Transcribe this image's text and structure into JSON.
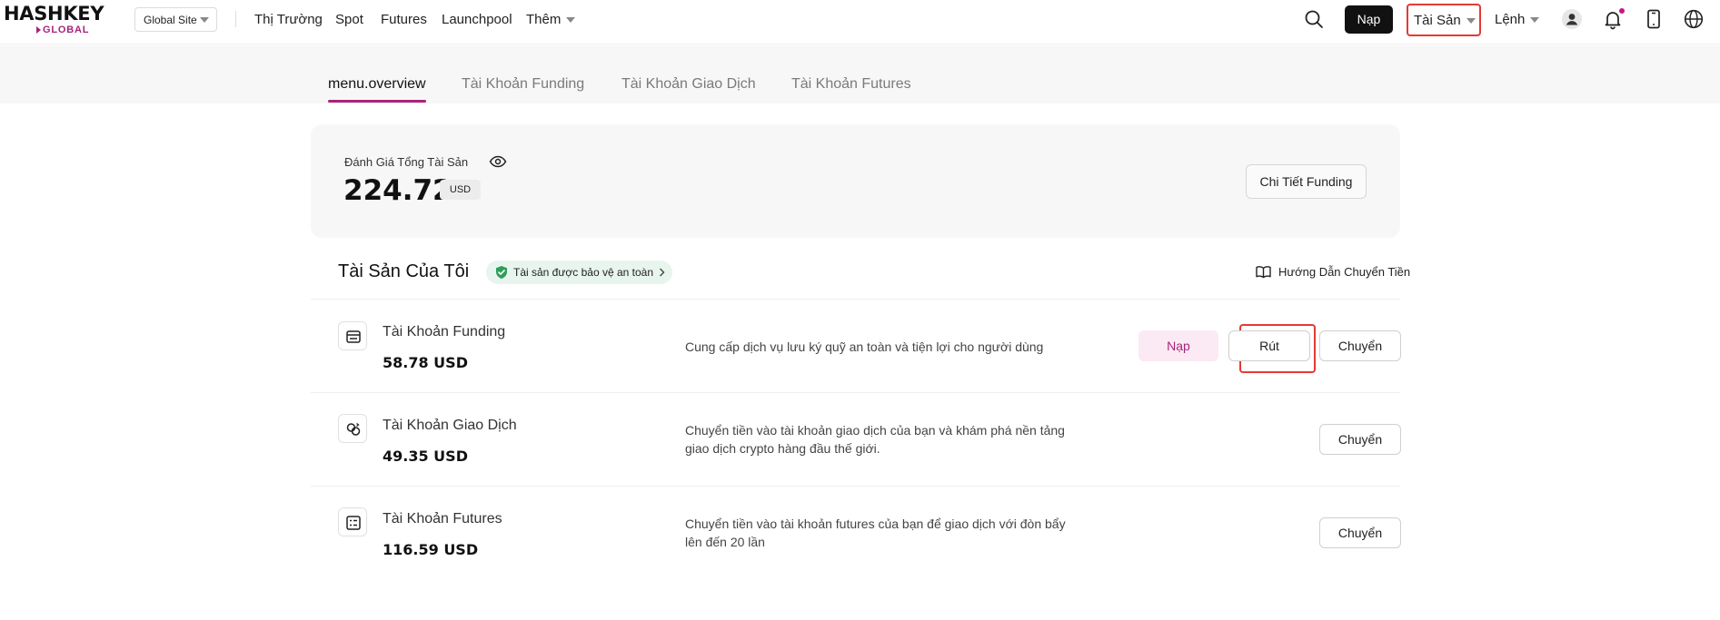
{
  "header": {
    "logo_main": "HASHKEY",
    "logo_sub": "GLOBAL",
    "site_select": "Global Site",
    "nav": [
      "Thị Trường",
      "Spot",
      "Futures",
      "Launchpool"
    ],
    "more": "Thêm",
    "deposit": "Nạp",
    "assets": "Tài Sản",
    "orders": "Lệnh"
  },
  "tabs": [
    "menu.overview",
    "Tài Khoản Funding",
    "Tài Khoản Giao Dịch",
    "Tài Khoản Futures"
  ],
  "overview": {
    "label": "Đánh Giá Tổng Tài Sản",
    "value": "224.72",
    "currency": "USD",
    "detail_button": "Chi Tiết Funding"
  },
  "my_assets": {
    "title": "Tài Sản Của Tôi",
    "safe_badge": "Tài sản được bảo vệ an toàn",
    "guide_link": "Hướng Dẫn Chuyển Tiền"
  },
  "accounts": [
    {
      "name": "Tài Khoản Funding",
      "balance": "58.78 USD",
      "description": "Cung cấp dịch vụ lưu ký quỹ an toàn và tiện lợi cho người dùng",
      "deposit": "Nạp",
      "withdraw": "Rút",
      "transfer": "Chuyển"
    },
    {
      "name": "Tài Khoản Giao Dịch",
      "balance": "49.35 USD",
      "description": "Chuyển tiền vào tài khoản giao dịch của bạn và khám phá nền tảng giao dịch crypto hàng đầu thế giới.",
      "transfer": "Chuyển"
    },
    {
      "name": "Tài Khoản Futures",
      "balance": "116.59 USD",
      "description": "Chuyển tiền vào tài khoản futures của bạn để giao dịch với đòn bẩy lên đến 20 lần",
      "transfer": "Chuyển"
    }
  ],
  "icons": {
    "search": "search-icon",
    "user": "user-avatar-icon",
    "bell": "bell-icon",
    "phone": "mobile-app-icon",
    "globe": "globe-icon",
    "eye": "eye-icon",
    "shield": "shield-check-icon",
    "book": "book-icon",
    "funding": "wallet-icon",
    "trading": "exchange-icon",
    "futures": "futures-icon"
  },
  "colors": {
    "accent": "#a8237c",
    "highlight": "#e53935",
    "safe_badge_bg": "#e8f5ee",
    "shield": "#2e9e5b"
  }
}
